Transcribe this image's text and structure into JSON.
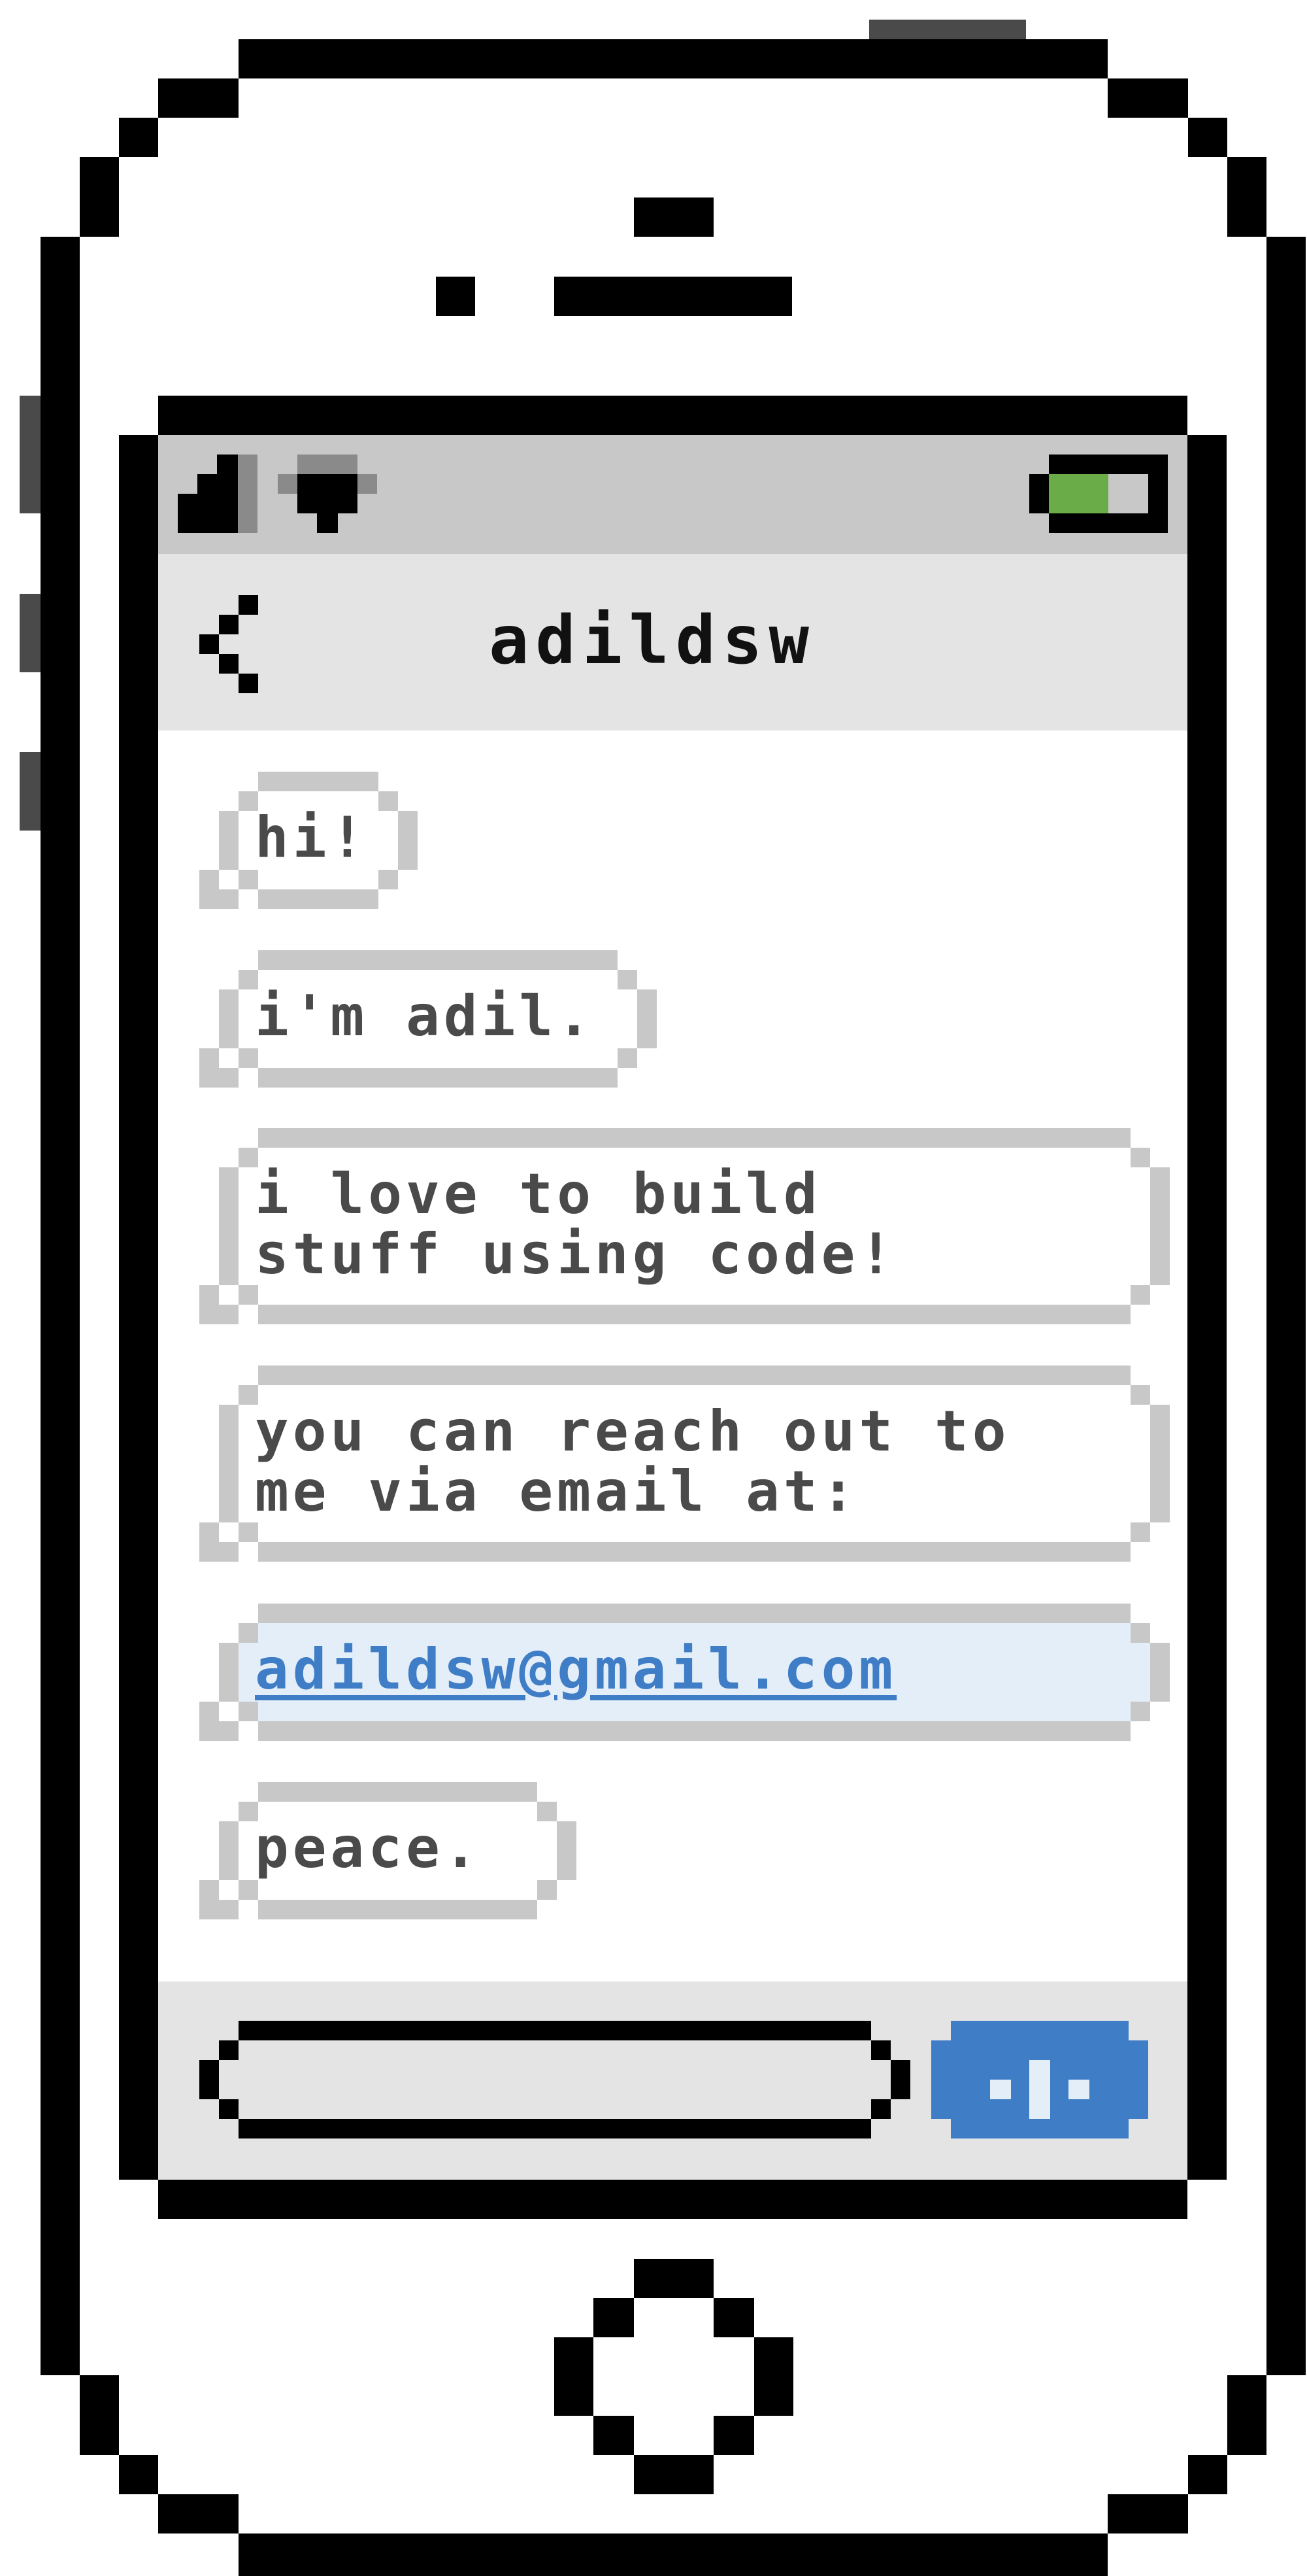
{
  "phone": {
    "colors": {
      "outline": "#000000",
      "screen_status": "#c8c8c8",
      "screen_header": "#e4e4e4",
      "bubble_border": "#c8c8c8",
      "text": "#4a4a4a",
      "link_bg": "#e4eef8",
      "link": "#3f7ec6",
      "send_button": "#3f7ec6",
      "battery": "#6aad48"
    }
  },
  "status_bar": {
    "signal_icon": "signal-icon",
    "wifi_icon": "wifi-icon",
    "battery_icon": "battery-icon",
    "battery_level": 0.6
  },
  "header": {
    "back_icon": "chevron-left-icon",
    "title": "adildsw"
  },
  "messages": [
    {
      "lines": [
        "hi!"
      ]
    },
    {
      "lines": [
        "i'm adil."
      ]
    },
    {
      "lines": [
        "i love to build",
        "stuff using code!"
      ]
    },
    {
      "lines": [
        "you can reach out to",
        "me via email at:"
      ]
    },
    {
      "lines": [
        "adildsw@gmail.com"
      ],
      "link": true
    },
    {
      "lines": [
        "peace."
      ]
    }
  ],
  "composer": {
    "input_value": "",
    "send_icon": "arrow-up-icon"
  },
  "home_button_icon": "home-button-icon"
}
